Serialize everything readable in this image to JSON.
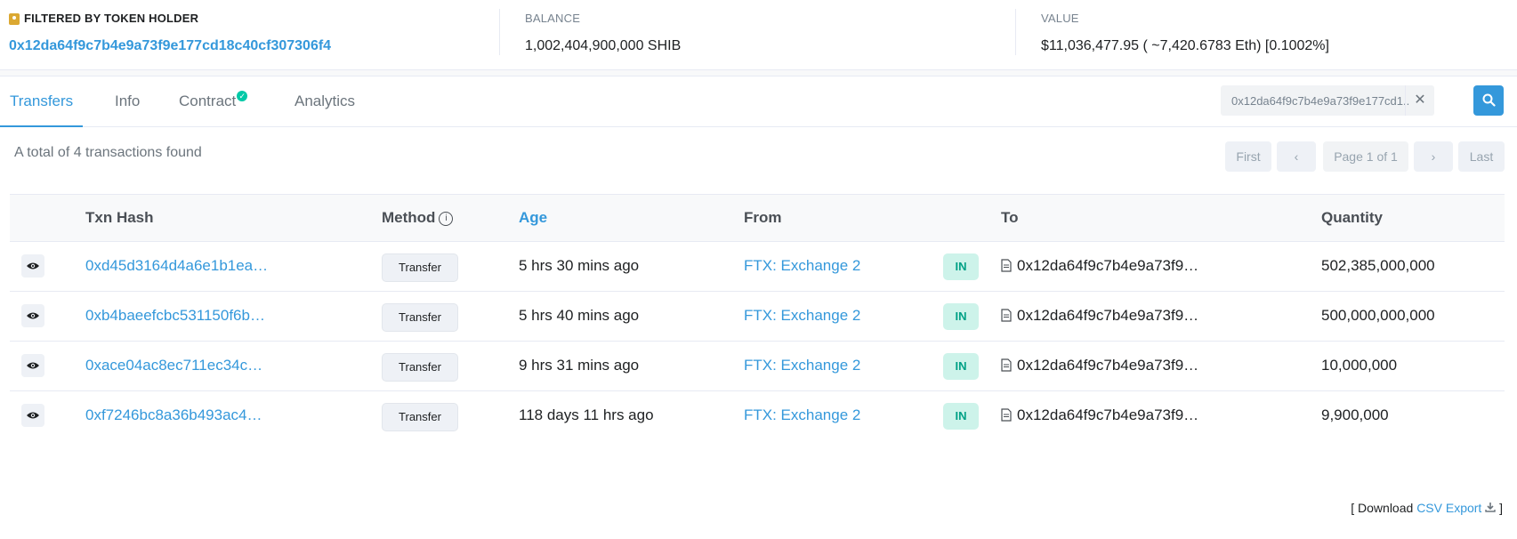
{
  "summary": {
    "holder_label": "FILTERED BY TOKEN HOLDER",
    "holder_address": "0x12da64f9c7b4e9a73f9e177cd18c40cf307306f4",
    "balance_label": "BALANCE",
    "balance_value": "1,002,404,900,000 SHIB",
    "value_label": "VALUE",
    "value_value": "$11,036,477.95 ( ~7,420.6783 Eth) [0.1002%]"
  },
  "tabs": [
    {
      "label": "Transfers",
      "active": true
    },
    {
      "label": "Info",
      "active": false
    },
    {
      "label": "Contract",
      "active": false,
      "verified": true
    },
    {
      "label": "Analytics",
      "active": false
    }
  ],
  "search": {
    "value": "0x12da64f9c7b4e9a73f9e177cd1..."
  },
  "total_text": "A total of 4 transactions found",
  "pagination": {
    "first": "First",
    "prev": "‹",
    "page": "Page 1 of 1",
    "next": "›",
    "last": "Last"
  },
  "table": {
    "columns": {
      "txn_hash": "Txn Hash",
      "method": "Method",
      "age": "Age",
      "from": "From",
      "to": "To",
      "quantity": "Quantity"
    },
    "rows": [
      {
        "hash": "0xd45d3164d4a6e1b1ea…",
        "method": "Transfer",
        "age": "5 hrs 30 mins ago",
        "from": "FTX: Exchange 2",
        "direction": "IN",
        "to": "0x12da64f9c7b4e9a73f9…",
        "quantity": "502,385,000,000"
      },
      {
        "hash": "0xb4baeefcbc531150f6b…",
        "method": "Transfer",
        "age": "5 hrs 40 mins ago",
        "from": "FTX: Exchange 2",
        "direction": "IN",
        "to": "0x12da64f9c7b4e9a73f9…",
        "quantity": "500,000,000,000"
      },
      {
        "hash": "0xace04ac8ec711ec34c…",
        "method": "Transfer",
        "age": "9 hrs 31 mins ago",
        "from": "FTX: Exchange 2",
        "direction": "IN",
        "to": "0x12da64f9c7b4e9a73f9…",
        "quantity": "10,000,000"
      },
      {
        "hash": "0xf7246bc8a36b493ac4…",
        "method": "Transfer",
        "age": "118 days 11 hrs ago",
        "from": "FTX: Exchange 2",
        "direction": "IN",
        "to": "0x12da64f9c7b4e9a73f9…",
        "quantity": "9,900,000"
      }
    ]
  },
  "download": {
    "prefix": "[ Download",
    "link": "CSV Export",
    "suffix": "]"
  },
  "colors": {
    "accent": "#3498db",
    "in_badge_bg": "#cdf3ea",
    "in_badge_text": "#00a186",
    "holder_icon": "#dba832"
  }
}
